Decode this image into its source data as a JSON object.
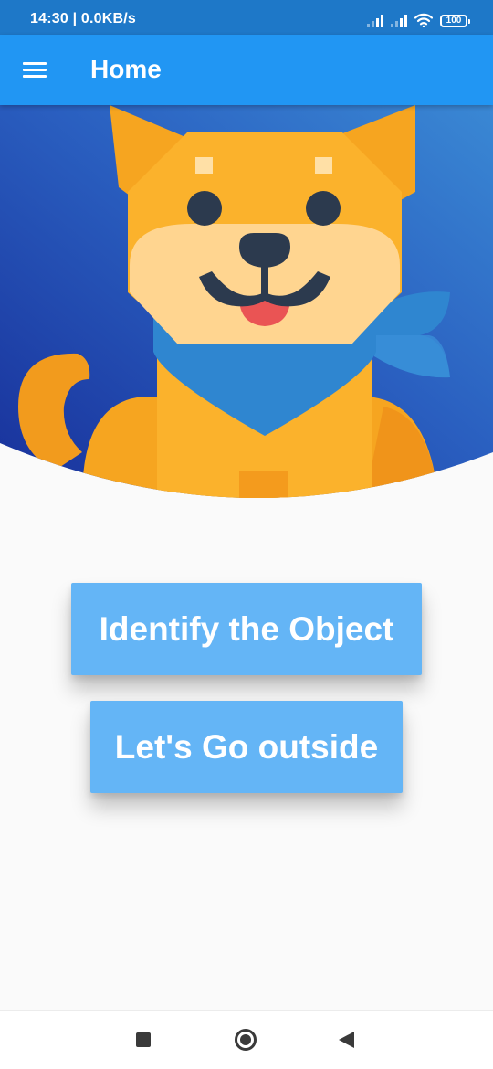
{
  "status_bar": {
    "time_speed": "14:30 | 0.0KB/s",
    "battery_level": "100",
    "icons": [
      "signal-icon",
      "signal-icon",
      "wifi-icon",
      "battery-icon"
    ]
  },
  "app_bar": {
    "menu_icon": "menu-icon",
    "title": "Home",
    "background": "#2196f3"
  },
  "hero": {
    "illustration": "shiba-dog-with-blue-bandana",
    "background_gradient": [
      "#1a3fa3",
      "#2d6cc9",
      "#3a8ad6"
    ]
  },
  "actions": {
    "identify_label": "Identify the Object",
    "outside_label": "Let's Go outside",
    "button_color": "#64b5f6"
  },
  "nav_bar": {
    "icons": [
      "recents-icon",
      "home-icon",
      "back-icon"
    ]
  }
}
